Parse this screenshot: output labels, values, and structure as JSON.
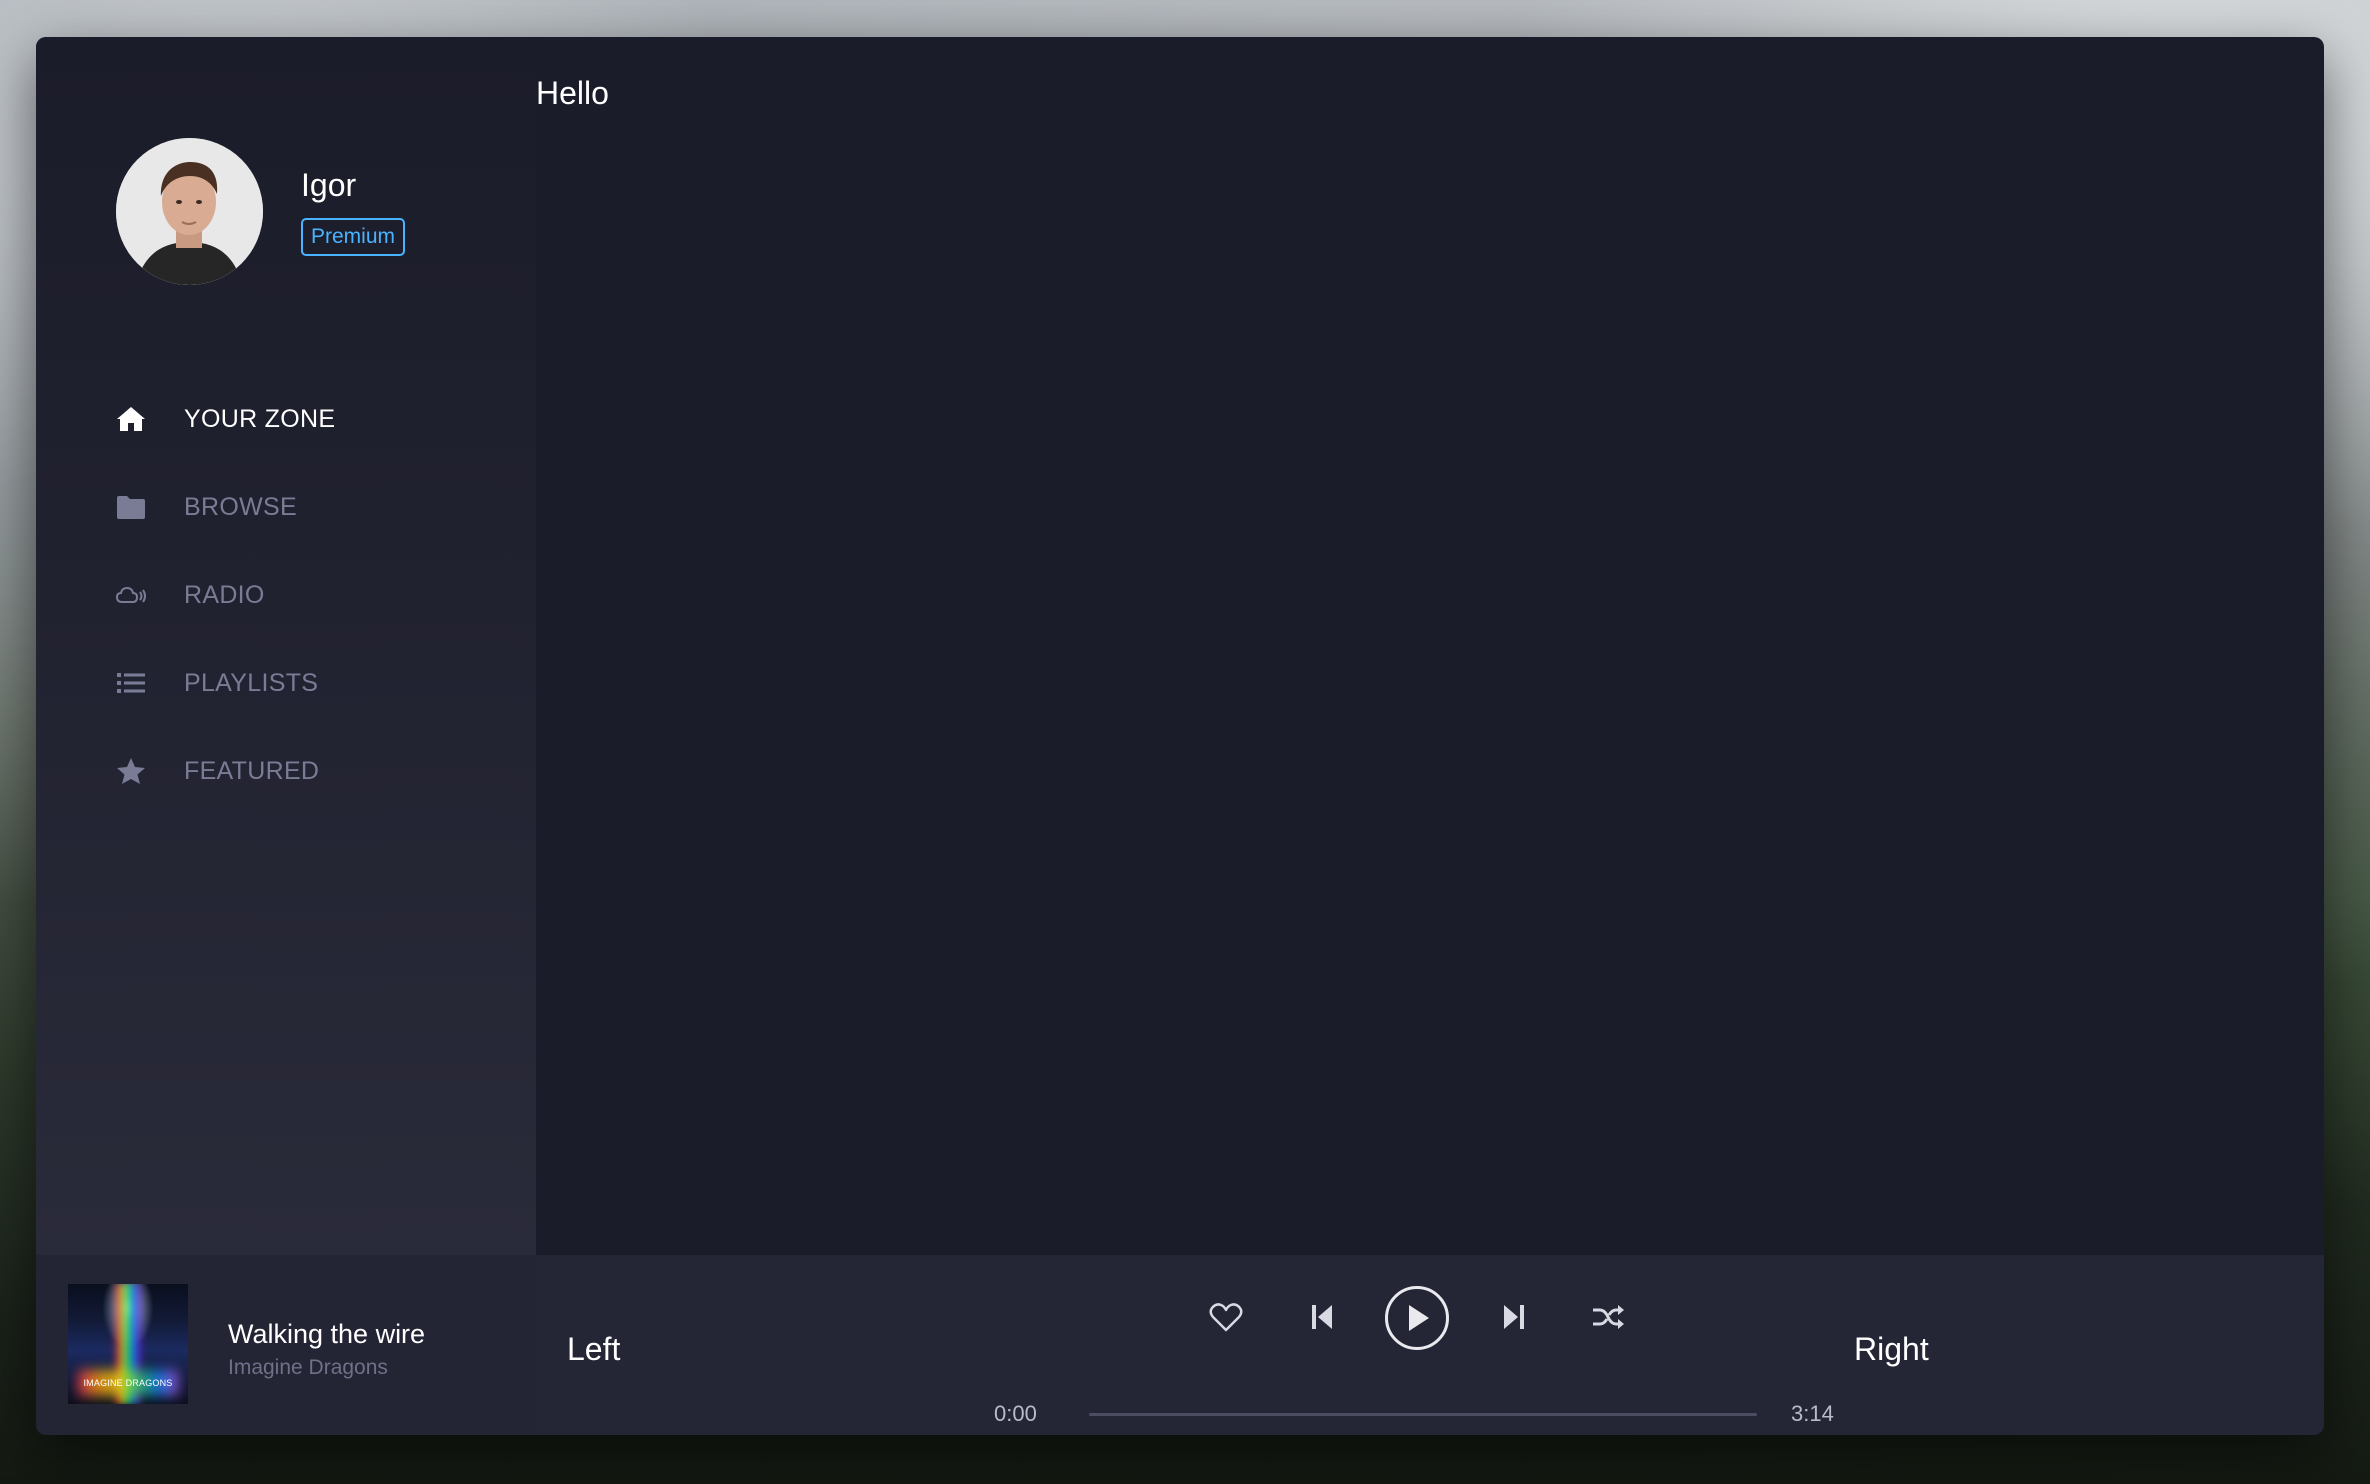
{
  "window": {
    "page_title": "Hello"
  },
  "profile": {
    "name": "Igor",
    "badge": "Premium"
  },
  "nav": [
    {
      "label": "YOUR ZONE",
      "icon": "home-icon",
      "active": true
    },
    {
      "label": "BROWSE",
      "icon": "folder-icon",
      "active": false
    },
    {
      "label": "RADIO",
      "icon": "radio-cloud-icon",
      "active": false
    },
    {
      "label": "PLAYLISTS",
      "icon": "list-icon",
      "active": false
    },
    {
      "label": "FEATURED",
      "icon": "star-icon",
      "active": false
    }
  ],
  "player": {
    "track_title": "Walking the wire",
    "track_artist": "Imagine Dragons",
    "album_text": "IMAGINE DRAGONS",
    "left_label": "Left",
    "right_label": "Right",
    "time_current": "0:00",
    "time_total": "3:14",
    "progress": 0
  },
  "colors": {
    "window_bg": "#1b1c29",
    "player_bg": "#242535",
    "accent": "#4ab3ff",
    "nav_inactive": "#7a7c95",
    "traffic_close": "#fd5f57",
    "traffic_min": "#febc2e",
    "traffic_max": "#28c840"
  }
}
